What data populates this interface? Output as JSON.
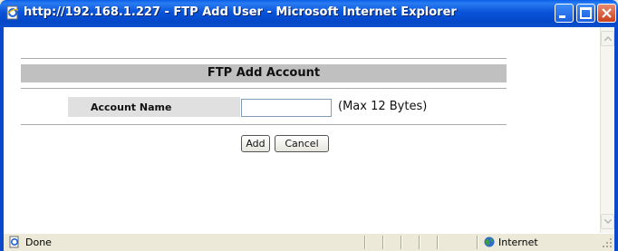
{
  "window": {
    "title": "http://192.168.1.227 - FTP Add User - Microsoft Internet Explorer"
  },
  "form": {
    "heading": "FTP Add Account",
    "account_label": "Account Name",
    "account_value": "",
    "account_hint": "(Max 12 Bytes)",
    "add_label": "Add",
    "cancel_label": "Cancel"
  },
  "statusbar": {
    "status": "Done",
    "zone": "Internet"
  },
  "colors": {
    "titlebar": "#0953d9",
    "header_bar": "#c0c0c0",
    "label_cell": "#e0e0e0"
  },
  "icons": {
    "window": "ie-page-icon",
    "status": "ie-page-icon",
    "zone": "globe-icon"
  }
}
